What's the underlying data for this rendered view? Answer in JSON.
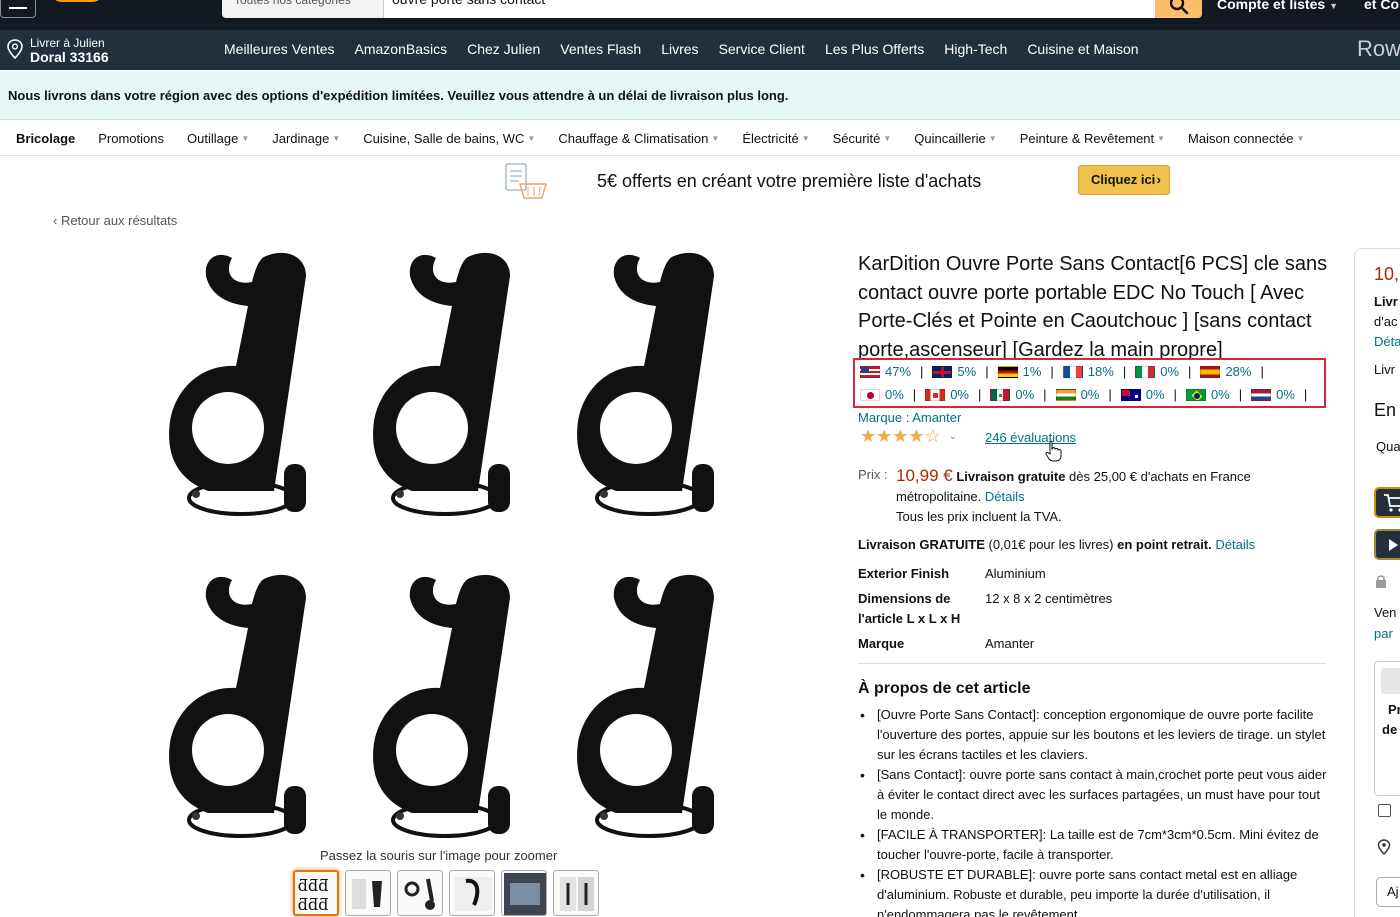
{
  "header": {
    "search_department": "Toutes nos catégories",
    "search_query": "ouvre porte sans contact",
    "account_label": "Compte et listes",
    "returns_label": "et Co"
  },
  "nav": {
    "deliver_line1": "Livrer à Julien",
    "deliver_line2": "Doral 33166",
    "links": [
      "Meilleures Ventes",
      "AmazonBasics",
      "Chez Julien",
      "Ventes Flash",
      "Livres",
      "Service Client",
      "Les Plus Offerts",
      "High-Tech",
      "Cuisine et Maison"
    ],
    "right_text": "Row"
  },
  "notice": "Nous livrons dans votre région avec des options d'expédition limitées. Veuillez vous attendre à un délai de livraison plus long.",
  "subnav": {
    "items": [
      {
        "label": "Bricolage",
        "dropdown": false
      },
      {
        "label": "Promotions",
        "dropdown": false
      },
      {
        "label": "Outillage",
        "dropdown": true
      },
      {
        "label": "Jardinage",
        "dropdown": true
      },
      {
        "label": "Cuisine, Salle de bains, WC",
        "dropdown": true
      },
      {
        "label": "Chauffage & Climatisation",
        "dropdown": true
      },
      {
        "label": "Électricité",
        "dropdown": true
      },
      {
        "label": "Sécurité",
        "dropdown": true
      },
      {
        "label": "Quincaillerie",
        "dropdown": true
      },
      {
        "label": "Peinture & Revêtement",
        "dropdown": true
      },
      {
        "label": "Maison connectée",
        "dropdown": true
      }
    ]
  },
  "promo": {
    "text": "5€ offerts en créant votre première liste d'achats",
    "button": "Cliquez ici"
  },
  "back_link": "Retour aux résultats",
  "image": {
    "zoom_hint": "Passez la souris sur l'image pour zoomer"
  },
  "product": {
    "title": "KarDition Ouvre Porte Sans Contact[6 PCS] cle sans contact ouvre porte portable EDC No Touch [ Avec Porte-Clés et Pointe en Caoutchouc ] [sans contact porte,ascenseur] [Gardez la main propre]",
    "marketplace_rates_row1": [
      {
        "flag": "us-flag-icon",
        "value": "47%"
      },
      {
        "flag": "uk-flag-icon",
        "value": "5%"
      },
      {
        "flag": "de-flag-icon",
        "value": "1%"
      },
      {
        "flag": "fr-flag-icon",
        "value": "18%"
      },
      {
        "flag": "it-flag-icon",
        "value": "0%"
      },
      {
        "flag": "es-flag-icon",
        "value": "28%"
      }
    ],
    "marketplace_rates_row2": [
      {
        "flag": "jp-flag-icon",
        "value": "0%"
      },
      {
        "flag": "ca-flag-icon",
        "value": "0%"
      },
      {
        "flag": "mx-flag-icon",
        "value": "0%"
      },
      {
        "flag": "in-flag-icon",
        "value": "0%"
      },
      {
        "flag": "au-flag-icon",
        "value": "0%"
      },
      {
        "flag": "br-flag-icon",
        "value": "0%"
      },
      {
        "flag": "nl-flag-icon",
        "value": "0%"
      }
    ],
    "brand": "Marque : Amanter",
    "rating": 3.5,
    "reviews": "246 évaluations",
    "price_label": "Prix :",
    "price": "10,99 €",
    "free_delivery": "Livraison gratuite",
    "delivery_rest": " dès 25,00 € d'achats en France métropolitaine.",
    "details_link": "Détails",
    "tax_note": "Tous les prix incluent la TVA.",
    "pickup_bold": "Livraison GRATUITE",
    "pickup_mid": " (0,01€ pour les livres) ",
    "pickup_bold2": "en point retrait.",
    "pickup_link": "Détails",
    "specs": [
      {
        "key": "Exterior Finish",
        "value": "Aluminium"
      },
      {
        "key": "Dimensions de l'article L x L x H",
        "value": "12 x 8 x 2 centimètres"
      },
      {
        "key": "Marque",
        "value": "Amanter"
      }
    ],
    "about_title": "À propos de cet article",
    "about": [
      "[Ouvre Porte Sans Contact]: conception ergonomique de ouvre porte facilite l'ouverture des portes, appuie sur les boutons et les leviers de tirage. un stylet sur les écrans tactiles et les claviers.",
      "[Sans Contact]: ouvre porte sans contact à main,crochet porte peut vous aider à éviter le contact direct avec les surfaces partagées, un must have pour tout le monde.",
      "[FACILE À TRANSPORTER]: La taille est de 7cm*3cm*0.5cm. Mini évitez de toucher l'ouvre-porte, facile à transporter.",
      "[ROBUSTE ET DURABLE]: ouvre porte sans contact metal est en alliage d'aluminium. Robuste et durable, peu importe la durée d'utilisation, il n'endommagera pas le revêtement."
    ]
  },
  "buybox": {
    "price": "10,",
    "line1": "Livr",
    "line2": "d'ac",
    "line3": "Déta",
    "line4": "Livr",
    "stock": "En",
    "qty": "Qua",
    "seller": "Ven",
    "seller2": "par",
    "gift1": "Pr",
    "gift2": "de",
    "add_button": "Aj"
  },
  "colors": {
    "header_bg": "#131921",
    "nav_bg": "#232f3e",
    "notice_bg": "#e6f6f4",
    "link": "#007185",
    "price": "#b12704",
    "highlight_border": "#d8263a",
    "promo_button": "#f0c14b"
  }
}
